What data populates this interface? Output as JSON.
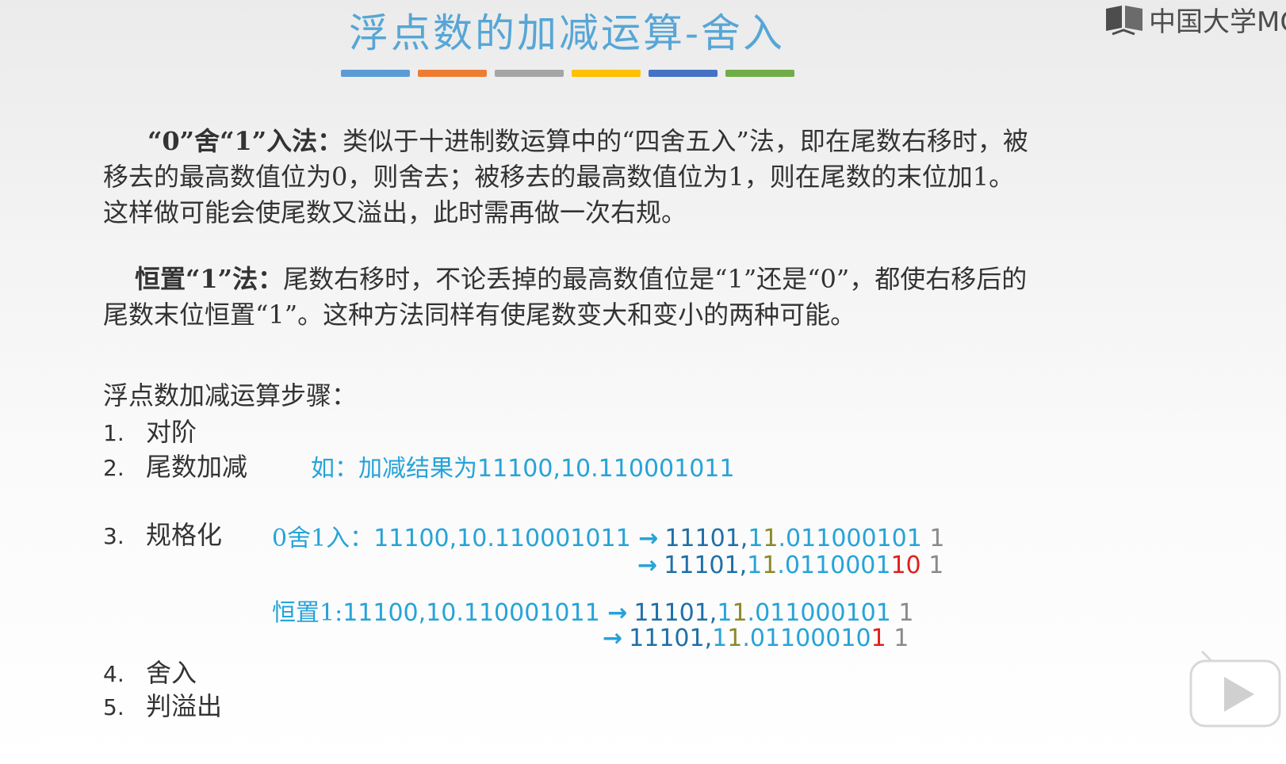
{
  "title": "浮点数的加减运算-舍入",
  "color_bars": [
    "#5b9bd5",
    "#ed7d31",
    "#a5a5a5",
    "#ffc000",
    "#4472c4",
    "#70ad47"
  ],
  "logo": {
    "text": "中国大学MO"
  },
  "para1": {
    "heading": "“0”舍“1”入法：",
    "body": "类似于十进制数运算中的“四舍五入”法，即在尾数右移时，被移去的最高数值位为0，则舍去；被移去的最高数值位为1，则在尾数的末位加1。这样做可能会使尾数又溢出，此时需再做一次右规。"
  },
  "para2": {
    "heading": "恒置“1”法：",
    "body": "尾数右移时，不论丢掉的最高数值位是“1”还是“0”，都使右移后的尾数末位恒置“1”。这种方法同样有使尾数变大和变小的两种可能。"
  },
  "steps_heading": "浮点数加减运算步骤：",
  "steps": [
    {
      "num": "1.",
      "label": "对阶"
    },
    {
      "num": "2.",
      "label": "尾数加减"
    },
    {
      "num": "3.",
      "label": "规格化"
    },
    {
      "num": "4.",
      "label": "舍入"
    },
    {
      "num": "5.",
      "label": "判溢出"
    }
  ],
  "example": {
    "prefix": "如：",
    "text": "加减结果为11100,10.110001011"
  },
  "round01": {
    "label": "0舍1入：",
    "source": "11100,10.110001011",
    "arrow": "→",
    "line1": {
      "exp": "11101,",
      "sign_a": "1",
      "sign_b": "1",
      "mant": ".011000101",
      "dropped": "1"
    },
    "line2": {
      "exp": "11101,",
      "sign_a": "1",
      "sign_b": "1",
      "mant": ".0110001",
      "changed": "10",
      "dropped": "1"
    }
  },
  "roundset1": {
    "label": "恒置1:",
    "source": "11100,10.110001011",
    "arrow": "→",
    "line1": {
      "exp": "11101,",
      "sign_a": "1",
      "sign_b": "1",
      "mant": ".011000101",
      "dropped": "1"
    },
    "line2": {
      "exp": "11101,",
      "sign_a": "1",
      "sign_b": "1",
      "mant": ".01100010",
      "changed": "1",
      "dropped": "1"
    }
  },
  "icons": {
    "logo": "book-icon",
    "player": "play-icon"
  }
}
